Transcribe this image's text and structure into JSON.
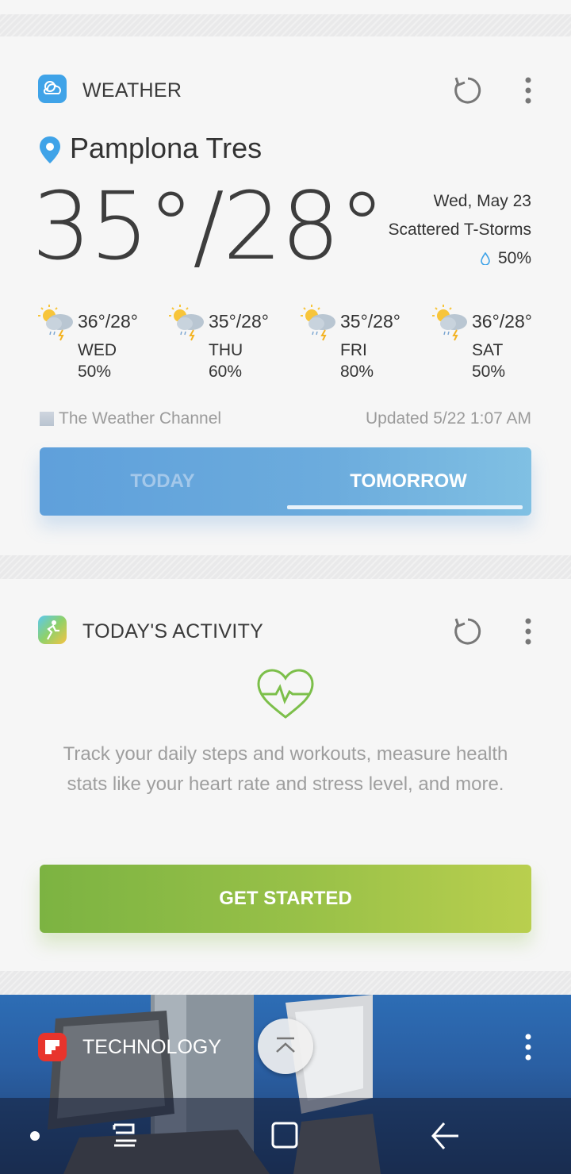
{
  "weather": {
    "title": "WEATHER",
    "location": "Pamplona Tres",
    "temps": "35°/28°",
    "date": "Wed, May 23",
    "condition": "Scattered T-Storms",
    "precip": "50%",
    "forecast": [
      {
        "temps": "36°/28°",
        "day": "WED",
        "precip": "50%"
      },
      {
        "temps": "35°/28°",
        "day": "THU",
        "precip": "60%"
      },
      {
        "temps": "35°/28°",
        "day": "FRI",
        "precip": "80%"
      },
      {
        "temps": "36°/28°",
        "day": "SAT",
        "precip": "50%"
      }
    ],
    "source": "The Weather Channel",
    "updated": "Updated 5/22 1:07 AM",
    "tabs": {
      "today": "TODAY",
      "tomorrow": "TOMORROW",
      "selected": "TOMORROW"
    }
  },
  "activity": {
    "title": "TODAY'S ACTIVITY",
    "description": "Track your daily steps and workouts, measure health stats like your heart rate and stress level, and more.",
    "button": "GET STARTED"
  },
  "technology": {
    "title": "TECHNOLOGY"
  },
  "icons": {
    "weather_app": "weather-cloud-icon",
    "refresh": "refresh-icon",
    "more": "more-vertical-icon",
    "location": "location-pin-icon",
    "drop": "raindrop-icon",
    "forecast": "partly-cloudy-storm-icon",
    "heart": "heart-rate-icon",
    "scroll_top": "scroll-to-top-icon"
  },
  "colors": {
    "weather_tab_gradient_start": "#5fa0db",
    "weather_tab_gradient_end": "#80c0e3",
    "activity_button_start": "#7cb342",
    "activity_button_end": "#b9cf4e",
    "flipboard_red": "#e8342c"
  }
}
